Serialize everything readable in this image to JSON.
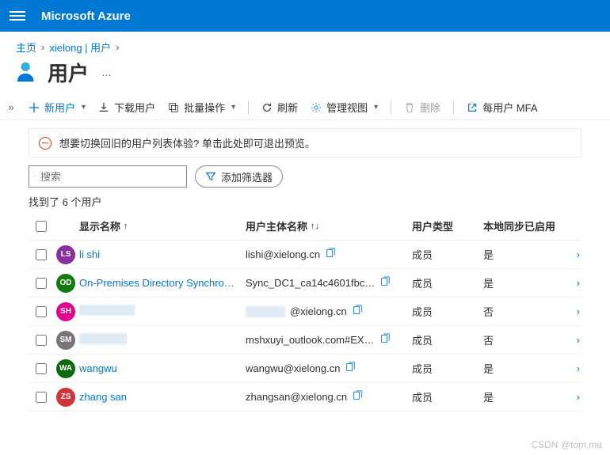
{
  "brand": "Microsoft Azure",
  "breadcrumb": {
    "home": "主页",
    "path": "xielong | 用户"
  },
  "page": {
    "title": "用户",
    "more": "…"
  },
  "toolbar": {
    "expand": "»",
    "new_user": "新用户",
    "download": "下载用户",
    "bulk": "批量操作",
    "refresh": "刷新",
    "manage_view": "管理视图",
    "delete": "删除",
    "mfa": "每用户 MFA"
  },
  "banner": "想要切换回旧的用户列表体验? 单击此处即可退出预览。",
  "search": {
    "placeholder": "搜索",
    "filter_label": "添加筛选器"
  },
  "count_text": "找到了 6 个用户",
  "columns": {
    "display_name": "显示名称",
    "upn": "用户主体名称",
    "type": "用户类型",
    "sync": "本地同步已启用",
    "sort_asc": "↑",
    "sort_both": "↑↓"
  },
  "values": {
    "type_member": "成员",
    "yes": "是",
    "no": "否"
  },
  "rows": [
    {
      "initials": "LS",
      "color": "#8b2fa0",
      "name": "li shi",
      "upn": "lishi@xielong.cn",
      "type": "成员",
      "sync": "是",
      "redacted": false
    },
    {
      "initials": "OD",
      "color": "#107c10",
      "name": "On-Premises Directory Synchro…",
      "upn": "Sync_DC1_ca14c4601fbc…",
      "type": "成员",
      "sync": "是",
      "redacted": false
    },
    {
      "initials": "SH",
      "color": "#e3008c",
      "name": "",
      "upn": "@xielong.cn",
      "type": "成员",
      "sync": "否",
      "redacted": true,
      "redact_name_w": 70,
      "redact_upn_w": 50
    },
    {
      "initials": "SM",
      "color": "#7a7574",
      "name": "",
      "upn": "mshxuyi_outlook.com#EX…",
      "type": "成员",
      "sync": "否",
      "redacted": true,
      "redact_name_w": 60
    },
    {
      "initials": "WA",
      "color": "#0b6a0b",
      "name": "wangwu",
      "upn": "wangwu@xielong.cn",
      "type": "成员",
      "sync": "是",
      "redacted": false
    },
    {
      "initials": "ZS",
      "color": "#d13438",
      "name": "zhang san",
      "upn": "zhangsan@xielong.cn",
      "type": "成员",
      "sync": "是",
      "redacted": false
    }
  ],
  "watermark": "CSDN @tom.ma"
}
